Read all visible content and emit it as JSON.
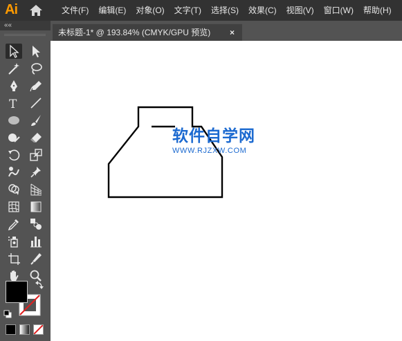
{
  "app": {
    "logo": "Ai",
    "colors": {
      "menubar": "#323232",
      "panel": "#535353",
      "canvas": "#ffffff",
      "logo": "#ff9a00",
      "watermark": "#1c6ad0"
    }
  },
  "menu": [
    {
      "id": "file",
      "label": "文件(F)"
    },
    {
      "id": "edit",
      "label": "编辑(E)"
    },
    {
      "id": "object",
      "label": "对象(O)"
    },
    {
      "id": "type",
      "label": "文字(T)"
    },
    {
      "id": "select",
      "label": "选择(S)"
    },
    {
      "id": "effect",
      "label": "效果(C)"
    },
    {
      "id": "view",
      "label": "视图(V)"
    },
    {
      "id": "window",
      "label": "窗口(W)"
    },
    {
      "id": "help",
      "label": "帮助(H)"
    }
  ],
  "document_tab": {
    "title": "未标题-1* @ 193.84% (CMYK/GPU 预览)",
    "close_glyph": "×"
  },
  "toolbar": {
    "collapse_glyph": "««",
    "tools": [
      {
        "name": "selection-tool",
        "icon": "arrow-icon",
        "selected": true
      },
      {
        "name": "direct-selection-tool",
        "icon": "white-arrow-icon"
      },
      {
        "name": "magic-wand-tool",
        "icon": "magic-wand-icon"
      },
      {
        "name": "lasso-tool",
        "icon": "lasso-icon"
      },
      {
        "name": "pen-tool",
        "icon": "pen-icon"
      },
      {
        "name": "curvature-tool",
        "icon": "curvature-pen-icon"
      },
      {
        "name": "type-tool",
        "icon": "type-icon",
        "glyph": "T"
      },
      {
        "name": "line-segment-tool",
        "icon": "line-icon"
      },
      {
        "name": "ellipse-tool",
        "icon": "ellipse-icon"
      },
      {
        "name": "paintbrush-tool",
        "icon": "brush-icon"
      },
      {
        "name": "shaper-tool",
        "icon": "shaper-icon"
      },
      {
        "name": "eraser-tool",
        "icon": "eraser-icon"
      },
      {
        "name": "rotate-tool",
        "icon": "rotate-icon"
      },
      {
        "name": "scale-tool",
        "icon": "scale-icon"
      },
      {
        "name": "warp-tool",
        "icon": "warp-icon"
      },
      {
        "name": "puppet-warp-tool",
        "icon": "pin-icon"
      },
      {
        "name": "shape-builder-tool",
        "icon": "shape-builder-icon"
      },
      {
        "name": "perspective-grid-tool",
        "icon": "perspective-grid-icon"
      },
      {
        "name": "mesh-tool",
        "icon": "mesh-icon"
      },
      {
        "name": "gradient-tool",
        "icon": "gradient-icon"
      },
      {
        "name": "eyedropper-tool",
        "icon": "eyedropper-icon"
      },
      {
        "name": "blend-tool",
        "icon": "blend-icon"
      },
      {
        "name": "symbol-sprayer-tool",
        "icon": "spray-icon"
      },
      {
        "name": "column-graph-tool",
        "icon": "bar-graph-icon"
      },
      {
        "name": "artboard-tool",
        "icon": "artboard-icon"
      },
      {
        "name": "slice-tool",
        "icon": "knife-icon"
      },
      {
        "name": "hand-tool",
        "icon": "hand-icon"
      },
      {
        "name": "zoom-tool",
        "icon": "zoom-icon"
      }
    ],
    "fill_color": "#000000",
    "stroke_color": "none",
    "swap_icon": "swap-arrow-icon",
    "default_colors_icon": "default-colors-icon",
    "color_modes": [
      {
        "name": "color-mode-button",
        "icon": "solid-color-icon"
      },
      {
        "name": "gradient-mode-button",
        "icon": "gradient-swatch-icon"
      },
      {
        "name": "none-mode-button",
        "icon": "none-swatch-icon"
      }
    ]
  },
  "canvas": {
    "watermark": {
      "title": "软件自学网",
      "url": "WWW.RJZXW.COM"
    }
  }
}
